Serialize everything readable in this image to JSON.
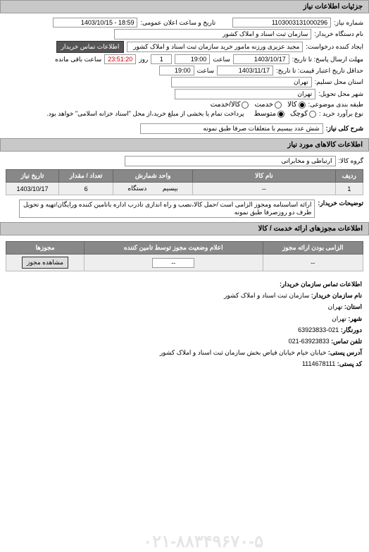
{
  "sections": {
    "details_header": "جزئیات اطلاعات نیاز",
    "goods_header": "اطلاعات کالاهای مورد نیاز",
    "permits_header": "اطلاعات مجوزهای ارائه خدمت / کالا",
    "contact_header": "اطلاعات تماس سازمان خریدار:"
  },
  "labels": {
    "need_no": "شماره نیاز:",
    "announce_date": "تاریخ و ساعت اعلان عمومی:",
    "buyer_org": "نام دستگاه خریدار:",
    "requester": "ایجاد کننده درخواست:",
    "buyer_contact_btn": "اطلاعات تماس خریدار",
    "reply_deadline": "مهلت ارسال پاسخ: تا تاریخ:",
    "time": "ساعت",
    "day": "روز",
    "remaining": "ساعت باقی مانده",
    "validity_until": "حداقل تاریخ اعتبار قیمت: تا تاریخ:",
    "location": "استان محل تسلیم:",
    "delivery_city": "شهر محل تحویل:",
    "subject_class": "طبقه بندی موضوعی:",
    "payment_type": "نوع برآورد خرید :",
    "payment_note": "پرداخت تمام یا بخشی از مبلغ خرید،از محل \"اسناد خزانه اسلامی\" خواهد بود.",
    "need_desc": "شرح کلی نیاز:",
    "goods_group": "گروه کالا:",
    "buyer_notes": "توضیحات خریدار:",
    "permit_required": "الزامی بودن ارائه مجوز",
    "permit_status": "اعلام وضعیت مجوز توسط تامین کننده",
    "permits_col": "مجوزها",
    "view_permit": "مشاهده مجوز"
  },
  "values": {
    "need_no": "1103003131000296",
    "announce_date": "18:59 - 1403/10/15",
    "buyer_org": "سازمان ثبت اسناد و املاک کشور",
    "requester": "مجید عزیزی ورزنه مامور خرید سازمان ثبت اسناد و املاک کشور",
    "reply_date": "1403/10/17",
    "reply_time": "19:00",
    "remaining_days": "1",
    "remaining_time": "23:51:20",
    "validity_date": "1403/11/17",
    "validity_time": "19:00",
    "location": "تهران",
    "delivery_city": "تهران",
    "need_desc": "شش عدد بیسیم با متعلقات صرفا طبق نمونه",
    "goods_group": "ارتباطی و مخابراتی",
    "buyer_notes": "ارائه اساسنامه ومجوز الزامی است /حمل کالا،نصب و راه اندازی تادرب اداره باتامین کننده ورایگان/تهیه و تحویل ظرف دو روزصرفا طبق نمونه",
    "permit_status_val": "--",
    "permit_required_val": "--"
  },
  "radios": {
    "class": {
      "opt1": "کالا",
      "opt2": "خدمت",
      "opt3": "کالا/خدمت"
    },
    "payment": {
      "opt1": "کوچک",
      "opt2": "متوسط"
    }
  },
  "table": {
    "headers": {
      "row": "ردیف",
      "name": "نام کالا",
      "unit": "واحد شمارش",
      "qty": "تعداد / مقدار",
      "date": "تاریخ نیاز"
    },
    "rows": [
      {
        "row": "1",
        "name": "--",
        "unit_label": "بیسیم",
        "unit_sub": "دستگاه",
        "qty": "6",
        "date": "1403/10/17"
      }
    ]
  },
  "contact": {
    "org_label": "نام سازمان خریدار:",
    "org": "سازمان ثبت اسناد و املاک کشور",
    "province_label": "استان:",
    "province": "تهران",
    "city_label": "شهر:",
    "city": "تهران",
    "phone_label": "دورنگار:",
    "phone": "021-63923833",
    "tel_label": "تلفن تماس:",
    "tel": "63923833-021",
    "address_label": "آدرس پستی:",
    "address": "خیابان خیام خیابان فیاض بخش سازمان ثبت اسناد و املاک کشور",
    "postal_label": "کد پستی:",
    "postal": "1114678111"
  },
  "watermark": "۰۲۱-۸۸۳۴۹۶۷۰-۵"
}
